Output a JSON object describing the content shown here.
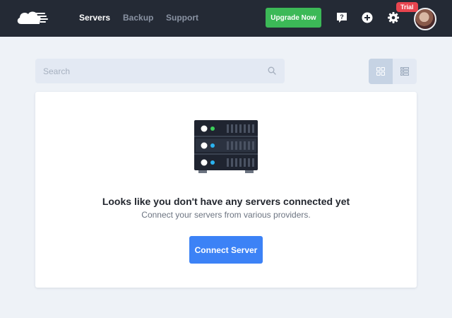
{
  "header": {
    "logo_icon": "cloud-logo-icon",
    "nav": [
      {
        "label": "Servers",
        "active": true
      },
      {
        "label": "Backup",
        "active": false
      },
      {
        "label": "Support",
        "active": false
      }
    ],
    "upgrade_label": "Upgrade Now",
    "icons": [
      "help-icon",
      "plus-circle-icon",
      "gear-icon"
    ],
    "trial_badge": "Trial"
  },
  "toolbar": {
    "search_placeholder": "Search",
    "search_value": "",
    "view_modes": [
      {
        "icon": "grid-view-icon",
        "active": true
      },
      {
        "icon": "list-view-icon",
        "active": false
      }
    ]
  },
  "empty_state": {
    "illustration": "server-rack-icon",
    "title": "Looks like you don't have any servers connected yet",
    "subtitle": "Connect your servers from various providers.",
    "button_label": "Connect Server"
  },
  "colors": {
    "topbar": "#242a35",
    "upgrade_button": "#3cb957",
    "primary_button": "#3c82f6",
    "trial_badge": "#e8454f",
    "page_background": "#eef2f7"
  }
}
